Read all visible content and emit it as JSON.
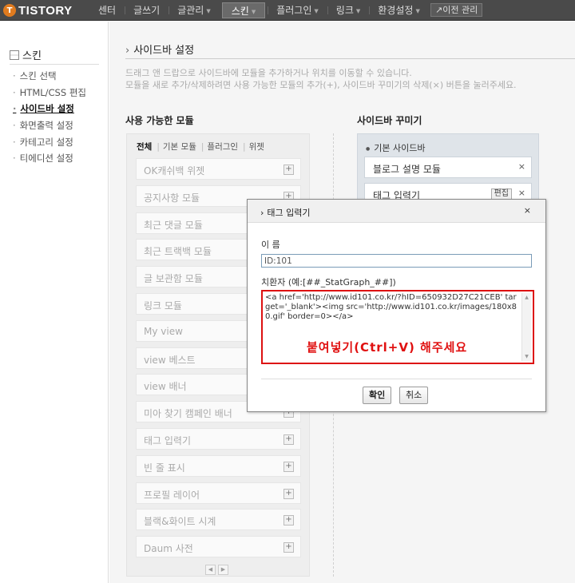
{
  "topbar": {
    "logo_mark": "T",
    "logo_text": "TISTORY",
    "nav": [
      {
        "label": "센터",
        "caret": false,
        "active": false
      },
      {
        "label": "글쓰기",
        "caret": false,
        "active": false
      },
      {
        "label": "글관리",
        "caret": true,
        "active": false
      },
      {
        "label": "스킨",
        "caret": true,
        "active": true
      },
      {
        "label": "플러그인",
        "caret": true,
        "active": false
      },
      {
        "label": "링크",
        "caret": true,
        "active": false
      },
      {
        "label": "환경설정",
        "caret": true,
        "active": false
      }
    ],
    "prev_admin": "↗이전 관리"
  },
  "sidebar": {
    "title": "스킨",
    "items": [
      "스킨 선택",
      "HTML/CSS 편집",
      "사이드바 설정",
      "화면출력 설정",
      "카테고리 설정",
      "티에디션 설정"
    ],
    "active_index": 2
  },
  "main": {
    "title": "사이드바 설정",
    "desc_line1": "드래그 앤 드랍으로 사이드바에 모듈을 추가하거나 위치를 이동할 수 있습니다.",
    "desc_line2": "모듈을 새로 추가/삭제하려면 사용 가능한 모듈의 추가(+), 사이드바 꾸미기의 삭제(×) 버튼을 눌러주세요.",
    "available": {
      "title": "사용 가능한 모듈",
      "filters": [
        "전체",
        "기본 모듈",
        "플러그인",
        "위젯"
      ],
      "filter_active": 0,
      "modules": [
        "OK캐쉬백 위젯",
        "공지사항 모듈",
        "최근 댓글 모듈",
        "최근 트랙백 모듈",
        "글 보관함 모듈",
        "링크 모듈",
        "My view",
        "view 베스트",
        "view 배너",
        "미아 찾기 캠페인 배너",
        "태그 입력기",
        "빈 줄 표시",
        "프로필 레이어",
        "블랙&화이트 시계",
        "Daum 사전"
      ],
      "plus": "+",
      "pager_prev": "◀",
      "pager_next": "▶"
    },
    "decorate": {
      "title": "사이드바 꾸미기",
      "subtitle": "기본 사이드바",
      "items": [
        {
          "label": "블로그 설명 모듈",
          "edit": ""
        },
        {
          "label": "태그 입력기",
          "edit": "편집"
        }
      ],
      "remove": "×"
    }
  },
  "dialog": {
    "title": "태그 입력기",
    "close": "×",
    "name_label": "이 름",
    "name_value": "ID:101",
    "replace_label": "치환자 (예:[##_StatGraph_##])",
    "code": "<a href='http://www.id101.co.kr/?hID=650932D27C21CEB' target='_blank'><img src='http://www.id101.co.kr/images/180x80.gif' border=0></a>",
    "annotation": "붙여넣기(Ctrl+V) 해주세요",
    "ok": "확인",
    "cancel": "취소"
  },
  "colors": {
    "topbar": "#4a4a4a",
    "annotation_red": "#e01010",
    "deco_panel": "#dfe4e9"
  }
}
